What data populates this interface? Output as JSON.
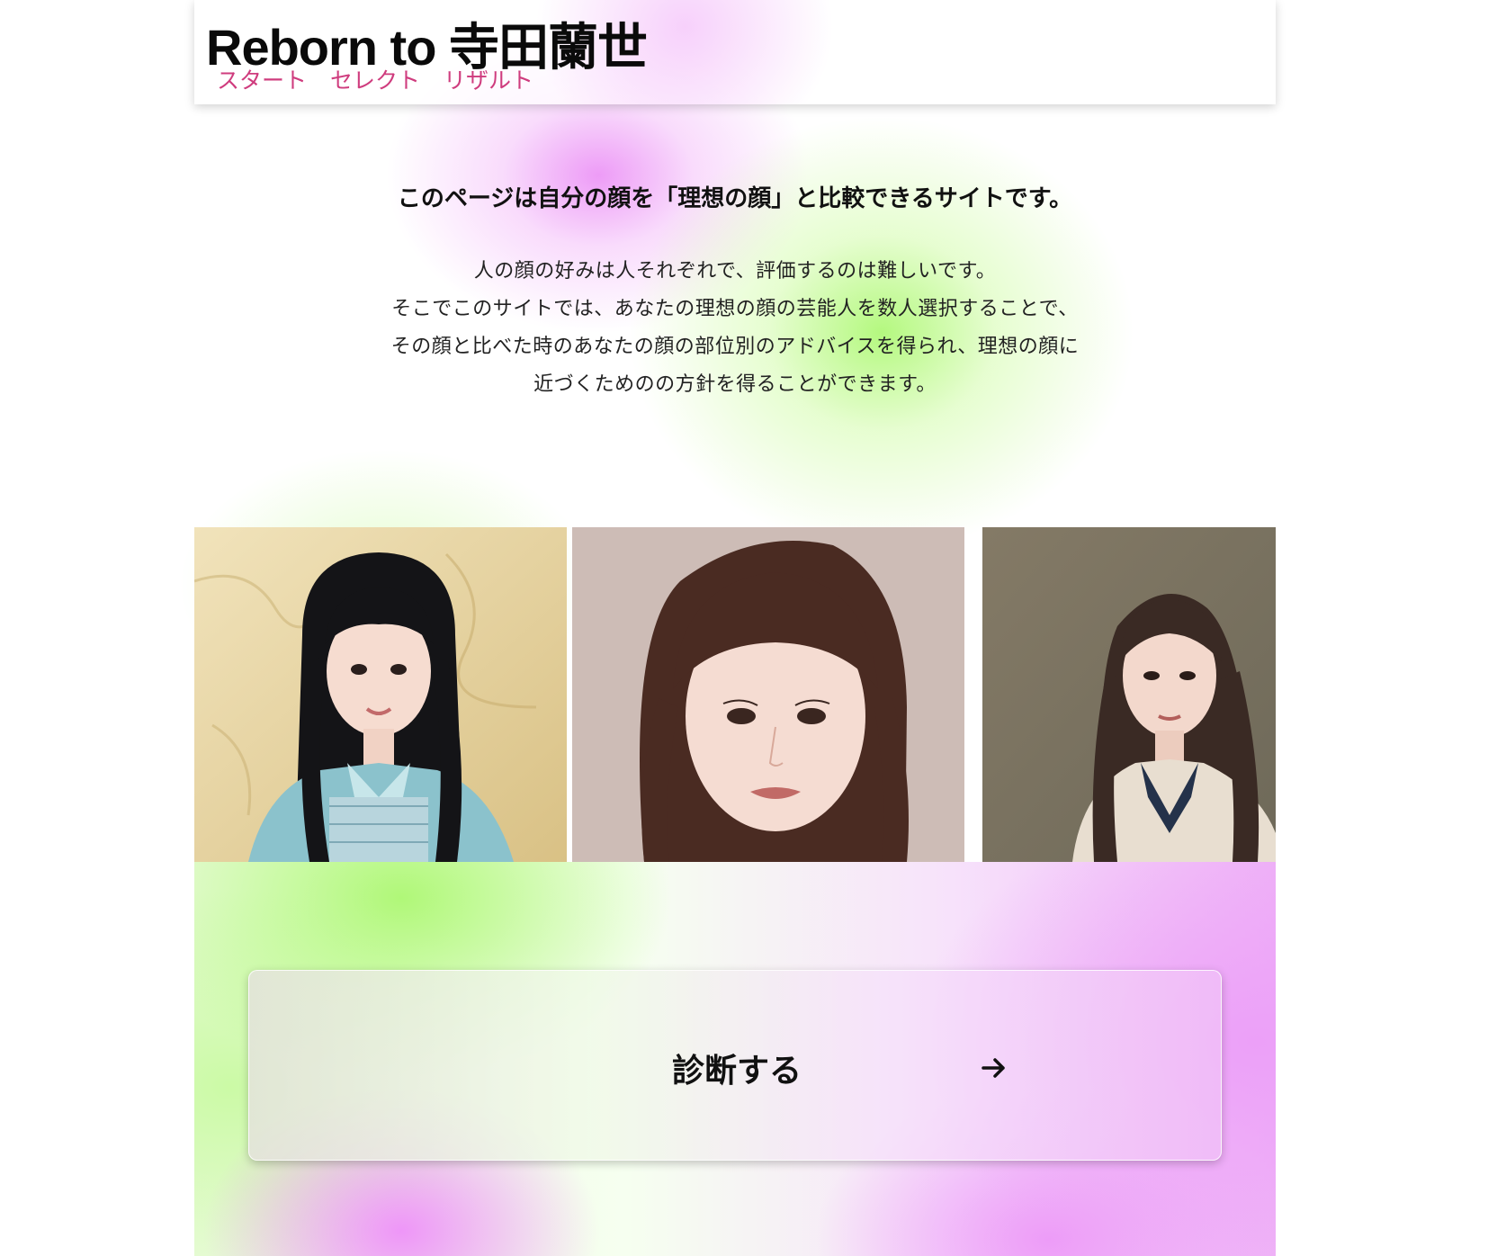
{
  "header": {
    "title": "Reborn to 寺田蘭世",
    "nav": [
      {
        "label": "スタート"
      },
      {
        "label": "セレクト"
      },
      {
        "label": "リザルト"
      }
    ]
  },
  "intro": {
    "headline": "このページは自分の顔を「理想の顔」と比較できるサイトです。",
    "body_lines": [
      "人の顔の好みは人それぞれで、評価するのは難しいです。",
      "そこでこのサイトでは、あなたの理想の顔の芸能人を数人選択することで、",
      "その顔と比べた時のあなたの顔の部位別のアドバイスを得られ、理想の顔に",
      "近づくためのの方針を得ることができます。"
    ]
  },
  "gallery": {
    "photos": [
      {
        "alt": "photo-1"
      },
      {
        "alt": "photo-2"
      },
      {
        "alt": "photo-3"
      }
    ]
  },
  "cta": {
    "label": "診断する",
    "icon": "arrow-right-icon"
  },
  "colors": {
    "accent_nav": "#cf3c7e",
    "pink_glow": "#ec96f6",
    "green_glow": "#b0f878"
  }
}
